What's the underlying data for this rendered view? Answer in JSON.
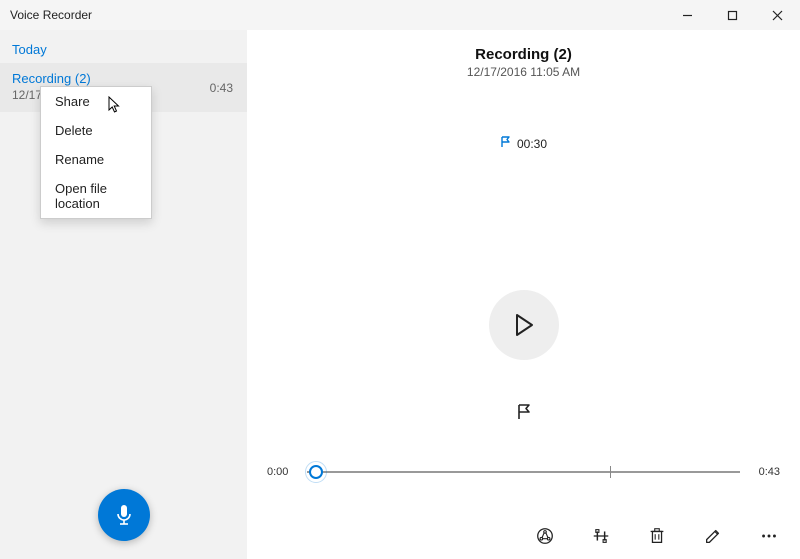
{
  "window": {
    "title": "Voice Recorder"
  },
  "sidebar": {
    "section_label": "Today",
    "items": [
      {
        "title": "Recording (2)",
        "date_partial": "12/17/",
        "duration": "0:43"
      }
    ]
  },
  "context_menu": {
    "items": [
      {
        "label": "Share"
      },
      {
        "label": "Delete"
      },
      {
        "label": "Rename"
      },
      {
        "label": "Open file location"
      }
    ]
  },
  "detail": {
    "title": "Recording (2)",
    "subtitle": "12/17/2016 11:05 AM",
    "marker_time": "00:30",
    "timeline": {
      "start": "0:00",
      "end": "0:43",
      "tick_fraction": 0.7,
      "thumb_fraction": 0.02
    }
  },
  "colors": {
    "accent": "#0078d7"
  }
}
